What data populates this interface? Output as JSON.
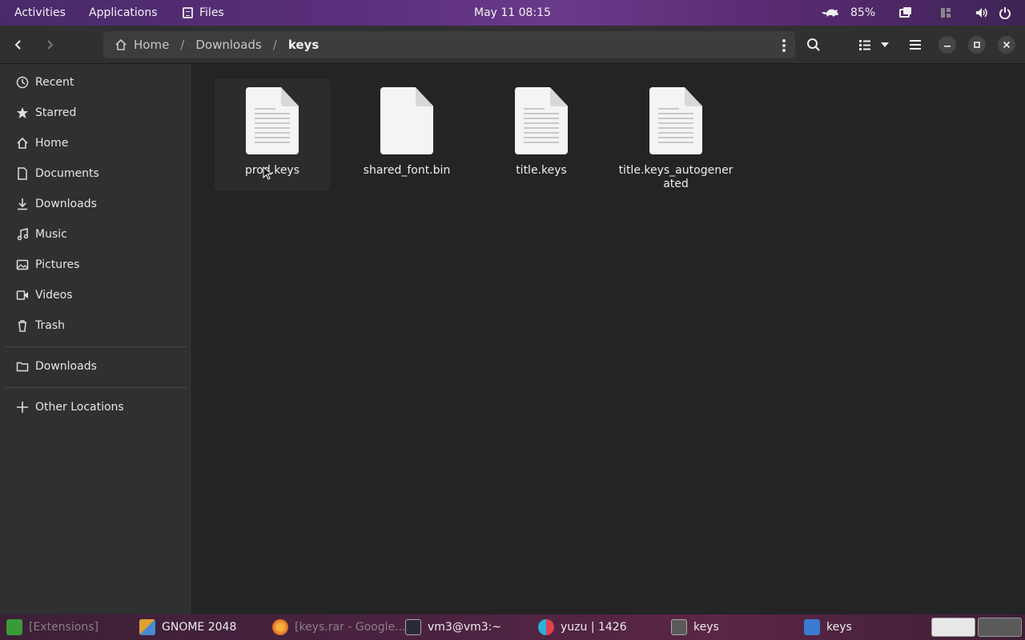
{
  "topbar": {
    "activities": "Activities",
    "applications": "Applications",
    "app_name": "Files",
    "clock": "May 11  08:15",
    "battery": "85%"
  },
  "header": {
    "breadcrumbs": [
      "Home",
      "Downloads",
      "keys"
    ]
  },
  "sidebar": {
    "items": [
      {
        "label": "Recent",
        "icon": "clock-icon"
      },
      {
        "label": "Starred",
        "icon": "star-icon"
      },
      {
        "label": "Home",
        "icon": "home-icon"
      },
      {
        "label": "Documents",
        "icon": "document-icon"
      },
      {
        "label": "Downloads",
        "icon": "download-icon"
      },
      {
        "label": "Music",
        "icon": "music-icon"
      },
      {
        "label": "Pictures",
        "icon": "picture-icon"
      },
      {
        "label": "Videos",
        "icon": "video-icon"
      },
      {
        "label": "Trash",
        "icon": "trash-icon"
      }
    ],
    "bookmarks": [
      {
        "label": "Downloads",
        "icon": "folder-icon"
      }
    ],
    "other_locations": "Other Locations"
  },
  "files": [
    {
      "name": "prod.keys",
      "icon": "text-file-icon"
    },
    {
      "name": "shared_font.bin",
      "icon": "binary-file-icon"
    },
    {
      "name": "title.keys",
      "icon": "text-file-icon"
    },
    {
      "name": "title.keys_autogenerated",
      "icon": "text-file-icon"
    }
  ],
  "taskbar": {
    "items": [
      {
        "label": "[Extensions]",
        "icon": "puzzle-icon",
        "color": "#3a9a3a"
      },
      {
        "label": "GNOME 2048",
        "icon": "gnome-2048-icon",
        "color": "#e0a030"
      },
      {
        "label": "[keys.rar - Google...",
        "icon": "firefox-icon",
        "color": "#e06a20"
      },
      {
        "label": "vm3@vm3:~",
        "icon": "terminal-icon",
        "color": "#2a2a3a"
      },
      {
        "label": "yuzu | 1426",
        "icon": "yuzu-icon",
        "color": "#2ab0e0"
      },
      {
        "label": "keys",
        "icon": "files-icon",
        "color": "#5a5a5a"
      },
      {
        "label": "keys",
        "icon": "text-editor-icon",
        "color": "#3a7ad0"
      }
    ]
  },
  "colors": {
    "accent": "#5b2f7c",
    "window_bg": "#242424",
    "sidebar_bg": "#303030"
  }
}
